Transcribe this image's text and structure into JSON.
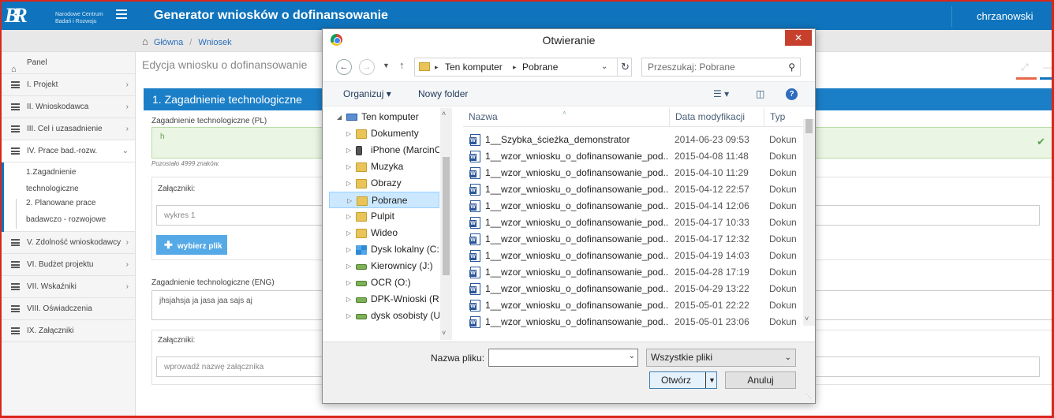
{
  "app": {
    "logo_mark": "BR",
    "logo_text": "Narodowe Centrum Badań i Rozwoju",
    "title": "Generator wniosków o dofinansowanie",
    "user": "chrzanowski",
    "brand_color": "#0f74bd"
  },
  "breadcrumb": [
    "Główna",
    "Wniosek"
  ],
  "sidebar": {
    "items": [
      {
        "label": "Panel",
        "icon": "home-icon"
      },
      {
        "label": "I. Projekt",
        "icon": "list-icon"
      },
      {
        "label": "II. Wnioskodawca",
        "icon": "list-icon"
      },
      {
        "label": "III. Cel i uzasadnienie",
        "icon": "list-icon"
      },
      {
        "label": "IV. Prace bad.-rozw.",
        "icon": "list-icon"
      },
      {
        "label": "V. Zdolność wnioskodawcy",
        "icon": "list-icon"
      },
      {
        "label": "VI. Budżet projektu",
        "icon": "list-icon"
      },
      {
        "label": "VII. Wskaźniki",
        "icon": "list-icon"
      },
      {
        "label": "VIII. Oświadczenia",
        "icon": "list-icon"
      },
      {
        "label": "IX. Załączniki",
        "icon": "list-icon"
      }
    ],
    "sub_items": [
      "1.Zagadnienie",
      "technologiczne",
      "2. Planowane prace",
      "badawczo - rozwojowe"
    ]
  },
  "main": {
    "title": "Edycja wniosku o dofinansowanie",
    "section": "1. Zagadnienie technologiczne",
    "pl_label": "Zagadnienie technologiczne (PL)",
    "pl_value": "h",
    "remaining": "Pozostało 4999 znaków.",
    "attachments_label": "Załączniki:",
    "attachment_value": "wykres 1",
    "pick_file": "wybierz plik",
    "eng_label": "Zagadnienie technologiczne (ENG)",
    "eng_value": "jhsjahsja  ja jasa jaa sajs aj",
    "attachments_label2": "Załączniki:",
    "attachment_placeholder": "wprowadź nazwę załącznika"
  },
  "dialog": {
    "title": "Otwieranie",
    "path": [
      "Ten komputer",
      "Pobrane"
    ],
    "search_placeholder": "Przeszukaj: Pobrane",
    "organize": "Organizuj",
    "new_folder": "Nowy folder",
    "tree": [
      {
        "label": "Ten komputer",
        "icon": "pc",
        "level": 0,
        "expanded": true
      },
      {
        "label": "Dokumenty",
        "icon": "folder",
        "level": 1
      },
      {
        "label": "iPhone (MarcinC",
        "icon": "phone",
        "level": 1
      },
      {
        "label": "Muzyka",
        "icon": "folder",
        "level": 1
      },
      {
        "label": "Obrazy",
        "icon": "folder",
        "level": 1
      },
      {
        "label": "Pobrane",
        "icon": "folder",
        "level": 1,
        "selected": true
      },
      {
        "label": "Pulpit",
        "icon": "folder",
        "level": 1
      },
      {
        "label": "Wideo",
        "icon": "folder",
        "level": 1
      },
      {
        "label": "Dysk lokalny (C:)",
        "icon": "win",
        "level": 1
      },
      {
        "label": "Kierownicy (J:)",
        "icon": "net",
        "level": 1
      },
      {
        "label": "OCR (O:)",
        "icon": "net",
        "level": 1
      },
      {
        "label": "DPK-Wnioski (R:)",
        "icon": "net",
        "level": 1
      },
      {
        "label": "dysk osobisty (U:",
        "icon": "net",
        "level": 1
      }
    ],
    "columns": [
      "Nazwa",
      "Data modyfikacji",
      "Typ"
    ],
    "files": [
      {
        "name": "1__Szybka_ścieżka_demonstrator",
        "date": "2014-06-23 09:53",
        "type": "Dokun"
      },
      {
        "name": "1__wzor_wniosku_o_dofinansowanie_pod...",
        "date": "2015-04-08 11:48",
        "type": "Dokun"
      },
      {
        "name": "1__wzor_wniosku_o_dofinansowanie_pod...",
        "date": "2015-04-10 11:29",
        "type": "Dokun"
      },
      {
        "name": "1__wzor_wniosku_o_dofinansowanie_pod...",
        "date": "2015-04-12 22:57",
        "type": "Dokun"
      },
      {
        "name": "1__wzor_wniosku_o_dofinansowanie_pod...",
        "date": "2015-04-14 12:06",
        "type": "Dokun"
      },
      {
        "name": "1__wzor_wniosku_o_dofinansowanie_pod...",
        "date": "2015-04-17 10:33",
        "type": "Dokun"
      },
      {
        "name": "1__wzor_wniosku_o_dofinansowanie_pod...",
        "date": "2015-04-17 12:32",
        "type": "Dokun"
      },
      {
        "name": "1__wzor_wniosku_o_dofinansowanie_pod...",
        "date": "2015-04-19 14:03",
        "type": "Dokun"
      },
      {
        "name": "1__wzor_wniosku_o_dofinansowanie_pod...",
        "date": "2015-04-28 17:19",
        "type": "Dokun"
      },
      {
        "name": "1__wzor_wniosku_o_dofinansowanie_pod...",
        "date": "2015-04-29 13:22",
        "type": "Dokun"
      },
      {
        "name": "1__wzor_wniosku_o_dofinansowanie_pod...",
        "date": "2015-05-01 22:22",
        "type": "Dokun"
      },
      {
        "name": "1__wzor_wniosku_o_dofinansowanie_pod...",
        "date": "2015-05-01 23:06",
        "type": "Dokun"
      }
    ],
    "filename_label": "Nazwa pliku:",
    "filename_value": "",
    "filter": "Wszystkie pliki",
    "open": "Otwórz",
    "cancel": "Anuluj"
  }
}
